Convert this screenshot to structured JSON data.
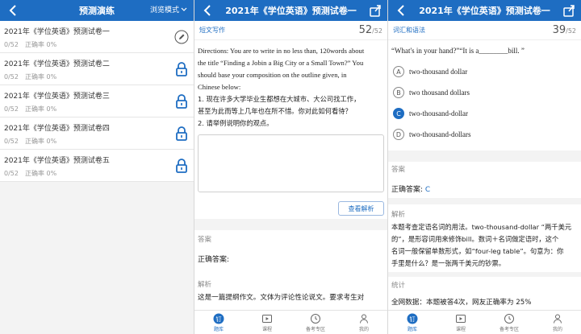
{
  "panel1": {
    "title": "预测演练",
    "mode_label": "浏览模式",
    "items": [
      {
        "title": "2021年《学位英语》预测试卷一",
        "progress": "0/52",
        "accuracy": "正确率 0%",
        "icon": "pencil-icon"
      },
      {
        "title": "2021年《学位英语》预测试卷二",
        "progress": "0/52",
        "accuracy": "正确率 0%",
        "icon": "lock-icon"
      },
      {
        "title": "2021年《学位英语》预测试卷三",
        "progress": "0/52",
        "accuracy": "正确率 0%",
        "icon": "lock-icon"
      },
      {
        "title": "2021年《学位英语》预测试卷四",
        "progress": "0/52",
        "accuracy": "正确率 0%",
        "icon": "lock-icon"
      },
      {
        "title": "2021年《学位英语》预测试卷五",
        "progress": "0/52",
        "accuracy": "正确率 0%",
        "icon": "lock-icon"
      }
    ]
  },
  "panel2": {
    "title": "2021年《学位英语》预测试卷一",
    "qtype": "短文写作",
    "qnum": "52",
    "qtotal": "/52",
    "lines": [
      "Directions: You are to write in no less than, 120words about",
      "the title “Finding a Jobin a Big City or a Small Town?” You",
      "should base your composition on the outline given, in",
      "Chinese below:",
      "1. 现在许多大学毕业生都想在大城市、大公司找工作，",
      "甚至为此而等上几年也在所不惜。你对此如何看待？",
      "2. 请举例说明你的观点。"
    ],
    "view_button": "查看解析",
    "answer_label": "答案",
    "correct_label": "正确答案:",
    "analysis_label": "解析",
    "analysis_text": "这是一篇提纲作文。文体为评论性论说文。要求考生对"
  },
  "panel3": {
    "title": "2021年《学位英语》预测试卷一",
    "qtype": "词汇和语法",
    "qnum": "39",
    "qtotal": "/52",
    "question": "“What's in your hand?”“It is a________bill. ”",
    "options": [
      {
        "letter": "A",
        "text": "two-thousand dollar",
        "selected": false
      },
      {
        "letter": "B",
        "text": "two thousand dollars",
        "selected": false
      },
      {
        "letter": "C",
        "text": "two-thousand-dollar",
        "selected": true
      },
      {
        "letter": "D",
        "text": "two-thousand-dollars",
        "selected": false
      }
    ],
    "answer_label": "答案",
    "correct_label": "正确答案:",
    "correct_value": "C",
    "analysis_label": "解析",
    "analysis_lines": [
      "本题考查定语名词的用法。two-thousand-dollar “两千美元",
      "的”，是形容词用来修饰bill。数词＋名词做定语时，这个",
      "名词一般保留单数形式，如“four-leg table”。句意为：你",
      "手里是什么？是一张两千美元的钞票。"
    ],
    "stats_label": "统计",
    "stats_text": "全网数据：本题被答4次，网友正确率为 25%"
  },
  "tabs": [
    {
      "label": "题库",
      "icon": "question-bank-icon",
      "active": true
    },
    {
      "label": "课程",
      "icon": "play-icon",
      "active": false
    },
    {
      "label": "备考专区",
      "icon": "exam-prep-icon",
      "active": false
    },
    {
      "label": "我的",
      "icon": "profile-icon",
      "active": false
    }
  ],
  "colors": {
    "brand": "#1e6dc2"
  }
}
